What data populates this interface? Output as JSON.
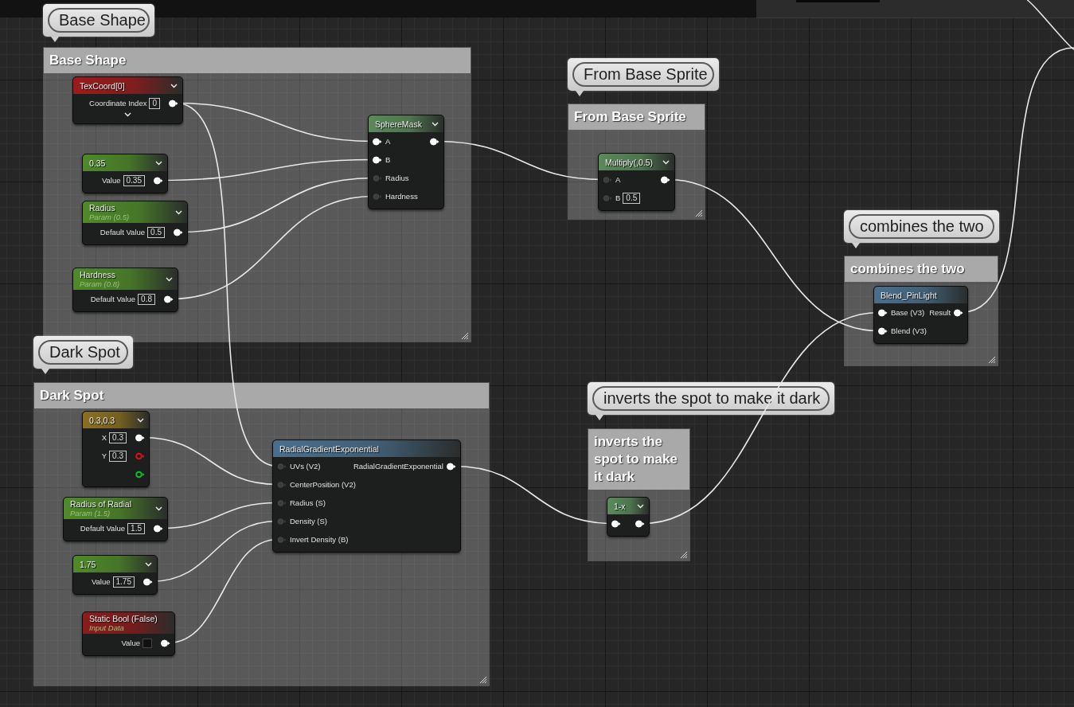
{
  "comments": [
    {
      "bubble": "Base Shape",
      "title": "Base Shape"
    },
    {
      "bubble": "Dark Spot",
      "title": "Dark Spot"
    },
    {
      "bubble": "From Base Sprite",
      "title": "From Base Sprite"
    },
    {
      "bubble": "combines the two",
      "title": "combines the two"
    },
    {
      "bubble": "inverts the spot to make it dark",
      "title": "inverts the spot to make it dark"
    }
  ],
  "nodes": [
    {
      "title": "TexCoord[0]",
      "color": "#9a1c1c",
      "dropdown": true,
      "expander": true,
      "rows": [
        {
          "label": "Coordinate Index",
          "value": "0",
          "out_pin": {
            "filled": true
          }
        }
      ]
    },
    {
      "title": "0.35",
      "color": "#4f8a2a",
      "dropdown": true,
      "expander": false,
      "rows": [
        {
          "label": "Value",
          "value": "0.35",
          "out_pin": {
            "filled": true
          }
        }
      ]
    },
    {
      "title": "Radius",
      "subtitle": "Param (0.5)",
      "color": "#4f8a2a",
      "dropdown": true,
      "expander": false,
      "rows": [
        {
          "label": "Default Value",
          "value": "0.5",
          "out_pin": {
            "filled": true
          }
        }
      ]
    },
    {
      "title": "Hardness",
      "subtitle": "Param (0.8)",
      "color": "#4f8a2a",
      "dropdown": true,
      "expander": false,
      "rows": [
        {
          "label": "Default Value",
          "value": "0.8",
          "out_pin": {
            "filled": true
          }
        }
      ]
    },
    {
      "title": "SphereMask",
      "color": "#5a8a5a",
      "dropdown": true,
      "expander": false,
      "rows": [
        {
          "in_pin": {
            "filled": true
          },
          "label": "A",
          "out_pin": {
            "filled": true
          }
        },
        {
          "in_pin": {
            "filled": true
          },
          "label": "B"
        },
        {
          "in_pin": {
            "filled": false
          },
          "label": "Radius"
        },
        {
          "in_pin": {
            "filled": false
          },
          "label": "Hardness"
        }
      ]
    },
    {
      "title": "0.3,0.3",
      "color": "#8a7020",
      "dropdown": true,
      "expander": false,
      "rows": [
        {
          "label": "X",
          "value": "0.3",
          "out_pin": {
            "filled": true
          }
        },
        {
          "label": "Y",
          "value": "0.3",
          "out_pin": {
            "filled": false,
            "color": "#e01010"
          }
        },
        {
          "out_pin": {
            "filled": false,
            "color": "#10c020"
          }
        }
      ]
    },
    {
      "title": "Radius of Radial",
      "subtitle": "Param (1.5)",
      "color": "#4f8a2a",
      "dropdown": true,
      "expander": false,
      "rows": [
        {
          "label": "Default Value",
          "value": "1.5",
          "out_pin": {
            "filled": true
          }
        }
      ]
    },
    {
      "title": "1.75",
      "color": "#4f8a2a",
      "dropdown": true,
      "expander": false,
      "rows": [
        {
          "label": "Value",
          "value": "1.75",
          "out_pin": {
            "filled": true
          }
        }
      ]
    },
    {
      "title": "Static Bool (False)",
      "subtitle": "Input Data",
      "color": "#8a1c1c",
      "dropdown": false,
      "expander": false,
      "rows": [
        {
          "label": "Value",
          "checked": false,
          "out_pin": {
            "filled": true
          }
        }
      ]
    },
    {
      "title": "RadialGradientExponential",
      "color": "#4a6f8c",
      "dropdown": false,
      "expander": false,
      "rows": [
        {
          "in_pin": {
            "filled": false
          },
          "label": "UVs (V2)",
          "out_pin": {
            "filled": true,
            "label": "RadialGradientExponential"
          }
        },
        {
          "in_pin": {
            "filled": false
          },
          "label": "CenterPosition (V2)"
        },
        {
          "in_pin": {
            "filled": false
          },
          "label": "Radius (S)"
        },
        {
          "in_pin": {
            "filled": false
          },
          "label": "Density (S)"
        },
        {
          "in_pin": {
            "filled": false
          },
          "label": "Invert Density (B)"
        }
      ]
    },
    {
      "title": "Multiply(,0.5)",
      "color": "#5a8a5a",
      "dropdown": true,
      "expander": false,
      "rows": [
        {
          "in_pin": {
            "filled": false
          },
          "label": "A",
          "out_pin": {
            "filled": true
          }
        },
        {
          "in_pin": {
            "filled": false
          },
          "label": "B",
          "value": "0.5"
        }
      ]
    },
    {
      "title": "1-x",
      "color": "#5a8a5a",
      "dropdown": true,
      "expander": false,
      "rows": [
        {
          "in_pin": {
            "filled": true
          },
          "out_pin": {
            "filled": true
          }
        }
      ]
    },
    {
      "title": "Blend_PinLight",
      "color": "#4a6f8c",
      "dropdown": false,
      "expander": false,
      "rows": [
        {
          "in_pin": {
            "filled": true
          },
          "label": "Base (V3)",
          "out_pin": {
            "filled": true,
            "label": "Result"
          }
        },
        {
          "in_pin": {
            "filled": true
          },
          "label": "Blend (V3)"
        }
      ]
    }
  ]
}
